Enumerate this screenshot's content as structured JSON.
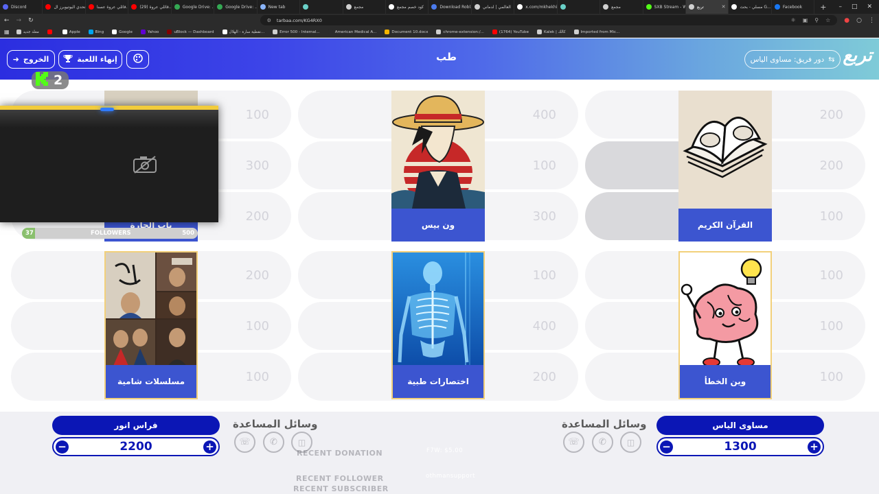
{
  "browser": {
    "tabs": [
      {
        "label": "Discord",
        "color": "#5865f2"
      },
      {
        "label": "تحدي اليوتيوبرز ال...",
        "color": "#ff0000"
      },
      {
        "label": "قائلي عروة عسنا...",
        "color": "#ff0000"
      },
      {
        "label": "(29) قائلي عروة...",
        "color": "#ff0000"
      },
      {
        "label": "Google Drive: ...",
        "color": "#34a853"
      },
      {
        "label": "Google Drive: ...",
        "color": "#34a853"
      },
      {
        "label": "New tab",
        "color": "#8ab4f8"
      },
      {
        "label": "",
        "color": "#6ad0c8"
      },
      {
        "label": "مجمع",
        "color": "#cfcfcf"
      },
      {
        "label": "كود خصم مجمع",
        "color": "#ffffff"
      },
      {
        "label": "Download Robl...",
        "color": "#4b7bec"
      },
      {
        "label": "العالمي | لدماني",
        "color": "#cfcfcf"
      },
      {
        "label": "x.com/mkhekhi...",
        "color": "#ffffff"
      },
      {
        "label": "",
        "color": "#6ad0c8"
      },
      {
        "label": "مجمع",
        "color": "#cfcfcf"
      },
      {
        "label": "SXB Stream - W...",
        "color": "#53fc18"
      },
      {
        "label": "تربع",
        "color": "#cfcfcf"
      },
      {
        "label": "مسلي - بحث G...",
        "color": "#ffffff"
      },
      {
        "label": "Facebook",
        "color": "#1877f2"
      }
    ],
    "active_tab_index": 16,
    "new_tab": "+",
    "url": "tarbaa.com/KG4RX0",
    "bookmarks": [
      {
        "label": "معلد جديد",
        "color": "#cfcfcf"
      },
      {
        "label": "",
        "color": "#ff0000"
      },
      {
        "label": "Apple",
        "color": "#ffffff"
      },
      {
        "label": "Bing",
        "color": "#00a4ef"
      },
      {
        "label": "Google",
        "color": "#ffffff"
      },
      {
        "label": "Yahoo",
        "color": "#6001d2"
      },
      {
        "label": "uBlock — Dashboard",
        "color": "#800000"
      },
      {
        "label": "نقطية سارة - الهلال...",
        "color": "#ffffff"
      },
      {
        "label": "Error 500 - Internal...",
        "color": "#cfcfcf"
      },
      {
        "label": "American Medical A...",
        "color": "#2b2b2b"
      },
      {
        "label": "Document 10.docx",
        "color": "#f4b400"
      },
      {
        "label": "chrome-extension:/...",
        "color": "#cfcfcf"
      },
      {
        "label": "(1764) YouTube",
        "color": "#ff0000"
      },
      {
        "label": "Kalek | كالك",
        "color": "#cfcfcf"
      },
      {
        "label": "Imported from Mic...",
        "color": "#cfcfcf"
      }
    ]
  },
  "header": {
    "logo": "تربع",
    "title": "طب",
    "turn_label": "دور فريق: مساوى الياس",
    "exit_label": "الخروج",
    "end_game_label": "إنهاء اللعبة"
  },
  "categories": [
    {
      "name": "القرآن الكريم",
      "art": "quran",
      "values": [
        200,
        200,
        100
      ]
    },
    {
      "name": "ون بيس",
      "art": "onepiece",
      "values": [
        400,
        100,
        300
      ]
    },
    {
      "name": "باب الحارة",
      "art": "bab",
      "values": [
        100,
        300,
        200
      ]
    },
    {
      "name": "وين الخطأ",
      "art": "brain",
      "values": [
        100,
        100,
        100
      ]
    },
    {
      "name": "اختصارات طبية",
      "art": "xray",
      "values": [
        100,
        400,
        200
      ]
    },
    {
      "name": "مسلسلات شامية",
      "art": "shamia",
      "values": [
        200,
        100,
        100
      ]
    }
  ],
  "stream_overlay": {
    "kick_count": "2",
    "followers_label": "FOLLOWERS",
    "followers_current": "37",
    "followers_goal": "500",
    "followers_fraction": 0.074,
    "recent_donation": "RECENT DONATION",
    "donation_value": "F7W: $5.00",
    "recent_follower": "RECENT FOLLOWER",
    "follower_value": "othmansupport",
    "recent_subscriber": "RECENT SUBSCRIBER"
  },
  "teams": [
    {
      "name": "مساوى الياس",
      "score": "1300",
      "aids_title": "وسائل المساعدة"
    },
    {
      "name": "فراس انور",
      "score": "2200",
      "aids_title": "وسائل المساعدة"
    }
  ],
  "colors": {
    "accent": "#0b16b5",
    "card_label": "#3c55d0"
  }
}
